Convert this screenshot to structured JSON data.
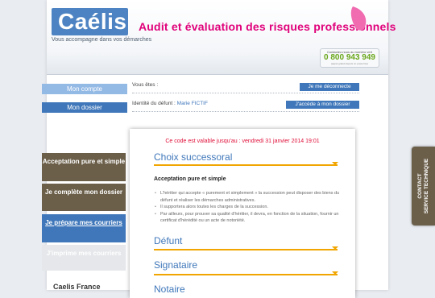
{
  "brand": {
    "logo_text": "Caélis",
    "tagline": "Vous accompagne dans vos démarches",
    "title": "Audit et évaluation des risques professionnels"
  },
  "contact": {
    "label": "Contactez-nous au numéro vert",
    "number": "0 800 943 949",
    "price": "(appel gratuit depuis un poste fixe)"
  },
  "sidebar": {
    "account_label": "Mon compte",
    "dossier_label": "Mon dossier",
    "steps": [
      {
        "label": "Acceptation pure et simple"
      },
      {
        "label": "Je complète mon dossier"
      },
      {
        "label": "Je prépare mes courriers"
      },
      {
        "label": "J'imprime mes courriers"
      }
    ],
    "footer_title": "Caelis France"
  },
  "account": {
    "you_are_label": "Vous êtes :",
    "you_are_value": "",
    "logout_label": "Je me déconnecte",
    "deceased_label": "Identité du défunt :",
    "deceased_value": "Marie FICTIF",
    "access_label": "J'accède à mon dossier"
  },
  "main": {
    "validity": "Ce code est valable jusqu'au : vendredi 31 janvier 2014 19:01",
    "section1_title": "Choix successoral",
    "subheading": "Acceptation pure et simple",
    "bullets": [
      "L'héritier qui accepte « purement et simplement » la succession peut disposer des biens du défunt et réaliser les démarches administratives.",
      "Il supportera alors toutes les charges de la succession.",
      "Par ailleurs, pour prouver sa qualité d'héritier, il devra, en fonction de la situation, fournir un certificat d'hérédité ou un acte de notoriété."
    ],
    "section2_title": "Défunt",
    "section3_title": "Signataire",
    "section4_title": "Notaire"
  },
  "side_tab": {
    "line1": "CONTACT",
    "line2": "SERVICE TECHNIQUE"
  },
  "colors": {
    "brand_blue": "#3f77ba",
    "accent_pink": "#e0007a",
    "accent_orange": "#f0a500",
    "step_brown": "#6b5f4a",
    "green": "#6aa71b"
  }
}
